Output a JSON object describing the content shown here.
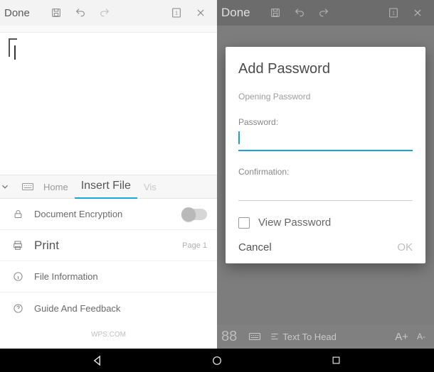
{
  "left": {
    "topbar": {
      "done": "Done"
    },
    "tabs": {
      "home": "Home",
      "insertFile": "Insert File",
      "vis": "Vis"
    },
    "rows": {
      "encryption": "Document Encryption",
      "print": "Print",
      "printMeta": "Page 1",
      "fileInfo": "File Information",
      "guide": "Guide And Feedback"
    },
    "footer": "WPS.COM"
  },
  "right": {
    "topbar": {
      "done": "Done"
    },
    "dialog": {
      "title": "Add Password",
      "opening": "Opening Password",
      "passwordLabel": "Password:",
      "confirmLabel": "Confirmation:",
      "viewPassword": "View Password",
      "cancel": "Cancel",
      "ok": "OK"
    },
    "bottombar": {
      "count": "88",
      "textToHead": "Text To Head",
      "aPlus": "A+",
      "aMinus": "A-"
    }
  }
}
